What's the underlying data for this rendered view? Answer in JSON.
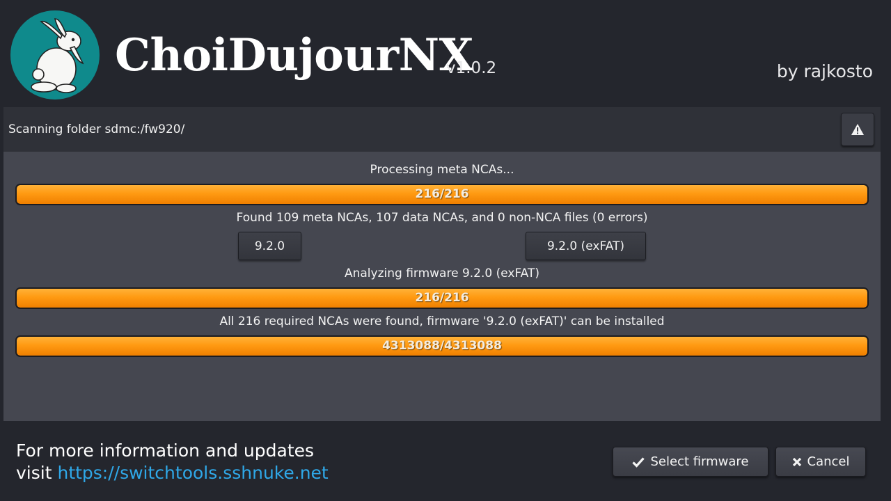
{
  "header": {
    "logo_icon": "rabbit-logo-icon",
    "title": "ChoiDujourNX",
    "version": "v1.0.2",
    "author": "by rajkosto"
  },
  "status_bar": {
    "text": "Scanning folder sdmc:/fw920/",
    "warning_icon": "warning-triangle-icon"
  },
  "steps": {
    "processing_label": "Processing meta NCAs...",
    "processing_progress": {
      "text": "216/216",
      "fraction": 1.0
    },
    "found_label": "Found 109 meta NCAs, 107 data NCAs, and 0 non-NCA files (0 errors)",
    "firmware_options": [
      "9.2.0",
      "9.2.0 (exFAT)"
    ],
    "analyzing_label": "Analyzing firmware 9.2.0 (exFAT)",
    "analyzing_progress": {
      "text": "216/216",
      "fraction": 1.0
    },
    "result_label": "All 216 required NCAs were found, firmware '9.2.0 (exFAT)' can be installed",
    "bytes_progress": {
      "text": "4313088/4313088",
      "fraction": 1.0
    }
  },
  "footer": {
    "info_line1": "For more information and updates",
    "info_visit": "visit",
    "info_link": "https://switchtools.sshnuke.net",
    "select_button": "Select firmware",
    "select_icon": "checkmark-icon",
    "cancel_button": "Cancel",
    "cancel_icon": "close-icon"
  },
  "colors": {
    "background": "#24262d",
    "panel": "#454750",
    "logo_circle": "#0f8a8c",
    "progress_fill": "#ff9a12",
    "link": "#2fa8e8"
  }
}
